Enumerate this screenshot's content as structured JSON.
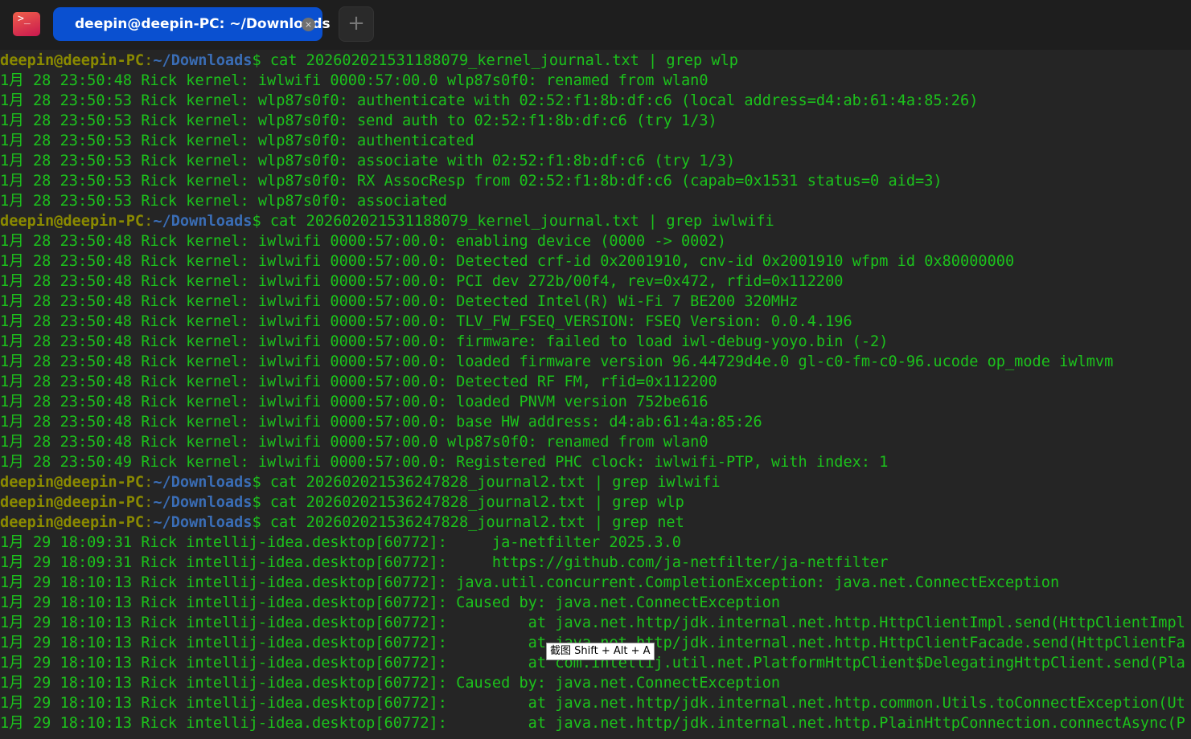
{
  "tabbar": {
    "icon": "terminal-icon",
    "tab_title": "deepin@deepin-PC: ~/Downloads",
    "close": "×",
    "add": "+"
  },
  "tooltip": "截图 Shift + Alt + A",
  "colors": {
    "output": "#1cc21c",
    "user": "#8a8a00",
    "path": "#3a6db5",
    "tab": "#0a50d0"
  },
  "lines": [
    {
      "user": "deepin@deepin-PC",
      "path": "~/Downloads",
      "cmd": " cat 202602021531188079_kernel_journal.txt | grep wlp"
    },
    {
      "text": "1月 28 23:50:48 Rick kernel: iwlwifi 0000:57:00.0 wlp87s0f0: renamed from wlan0"
    },
    {
      "text": "1月 28 23:50:53 Rick kernel: wlp87s0f0: authenticate with 02:52:f1:8b:df:c6 (local address=d4:ab:61:4a:85:26)"
    },
    {
      "text": "1月 28 23:50:53 Rick kernel: wlp87s0f0: send auth to 02:52:f1:8b:df:c6 (try 1/3)"
    },
    {
      "text": "1月 28 23:50:53 Rick kernel: wlp87s0f0: authenticated"
    },
    {
      "text": "1月 28 23:50:53 Rick kernel: wlp87s0f0: associate with 02:52:f1:8b:df:c6 (try 1/3)"
    },
    {
      "text": "1月 28 23:50:53 Rick kernel: wlp87s0f0: RX AssocResp from 02:52:f1:8b:df:c6 (capab=0x1531 status=0 aid=3)"
    },
    {
      "text": "1月 28 23:50:53 Rick kernel: wlp87s0f0: associated"
    },
    {
      "user": "deepin@deepin-PC",
      "path": "~/Downloads",
      "cmd": " cat 202602021531188079_kernel_journal.txt | grep iwlwifi"
    },
    {
      "text": "1月 28 23:50:48 Rick kernel: iwlwifi 0000:57:00.0: enabling device (0000 -> 0002)"
    },
    {
      "text": "1月 28 23:50:48 Rick kernel: iwlwifi 0000:57:00.0: Detected crf-id 0x2001910, cnv-id 0x2001910 wfpm id 0x80000000"
    },
    {
      "text": "1月 28 23:50:48 Rick kernel: iwlwifi 0000:57:00.0: PCI dev 272b/00f4, rev=0x472, rfid=0x112200"
    },
    {
      "text": "1月 28 23:50:48 Rick kernel: iwlwifi 0000:57:00.0: Detected Intel(R) Wi-Fi 7 BE200 320MHz"
    },
    {
      "text": "1月 28 23:50:48 Rick kernel: iwlwifi 0000:57:00.0: TLV_FW_FSEQ_VERSION: FSEQ Version: 0.0.4.196"
    },
    {
      "text": "1月 28 23:50:48 Rick kernel: iwlwifi 0000:57:00.0: firmware: failed to load iwl-debug-yoyo.bin (-2)"
    },
    {
      "text": "1月 28 23:50:48 Rick kernel: iwlwifi 0000:57:00.0: loaded firmware version 96.44729d4e.0 gl-c0-fm-c0-96.ucode op_mode iwlmvm"
    },
    {
      "text": "1月 28 23:50:48 Rick kernel: iwlwifi 0000:57:00.0: Detected RF FM, rfid=0x112200"
    },
    {
      "text": "1月 28 23:50:48 Rick kernel: iwlwifi 0000:57:00.0: loaded PNVM version 752be616"
    },
    {
      "text": "1月 28 23:50:48 Rick kernel: iwlwifi 0000:57:00.0: base HW address: d4:ab:61:4a:85:26"
    },
    {
      "text": "1月 28 23:50:48 Rick kernel: iwlwifi 0000:57:00.0 wlp87s0f0: renamed from wlan0"
    },
    {
      "text": "1月 28 23:50:49 Rick kernel: iwlwifi 0000:57:00.0: Registered PHC clock: iwlwifi-PTP, with index: 1"
    },
    {
      "user": "deepin@deepin-PC",
      "path": "~/Downloads",
      "cmd": " cat 202602021536247828_journal2.txt | grep iwlwifi"
    },
    {
      "user": "deepin@deepin-PC",
      "path": "~/Downloads",
      "cmd": " cat 202602021536247828_journal2.txt | grep wlp"
    },
    {
      "user": "deepin@deepin-PC",
      "path": "~/Downloads",
      "cmd": " cat 202602021536247828_journal2.txt | grep net"
    },
    {
      "text": "1月 29 18:09:31 Rick intellij-idea.desktop[60772]:     ja-netfilter 2025.3.0"
    },
    {
      "text": "1月 29 18:09:31 Rick intellij-idea.desktop[60772]:     https://github.com/ja-netfilter/ja-netfilter"
    },
    {
      "text": "1月 29 18:10:13 Rick intellij-idea.desktop[60772]: java.util.concurrent.CompletionException: java.net.ConnectException"
    },
    {
      "text": "1月 29 18:10:13 Rick intellij-idea.desktop[60772]: Caused by: java.net.ConnectException"
    },
    {
      "text": "1月 29 18:10:13 Rick intellij-idea.desktop[60772]:         at java.net.http/jdk.internal.net.http.HttpClientImpl.send(HttpClientImpl"
    },
    {
      "text": "1月 29 18:10:13 Rick intellij-idea.desktop[60772]:         at java.net.http/jdk.internal.net.http.HttpClientFacade.send(HttpClientFa"
    },
    {
      "text": "1月 29 18:10:13 Rick intellij-idea.desktop[60772]:         at com.intellij.util.net.PlatformHttpClient$DelegatingHttpClient.send(Pla"
    },
    {
      "text": "1月 29 18:10:13 Rick intellij-idea.desktop[60772]: Caused by: java.net.ConnectException"
    },
    {
      "text": "1月 29 18:10:13 Rick intellij-idea.desktop[60772]:         at java.net.http/jdk.internal.net.http.common.Utils.toConnectException(Ut"
    },
    {
      "text": "1月 29 18:10:13 Rick intellij-idea.desktop[60772]:         at java.net.http/jdk.internal.net.http.PlainHttpConnection.connectAsync(P"
    }
  ]
}
